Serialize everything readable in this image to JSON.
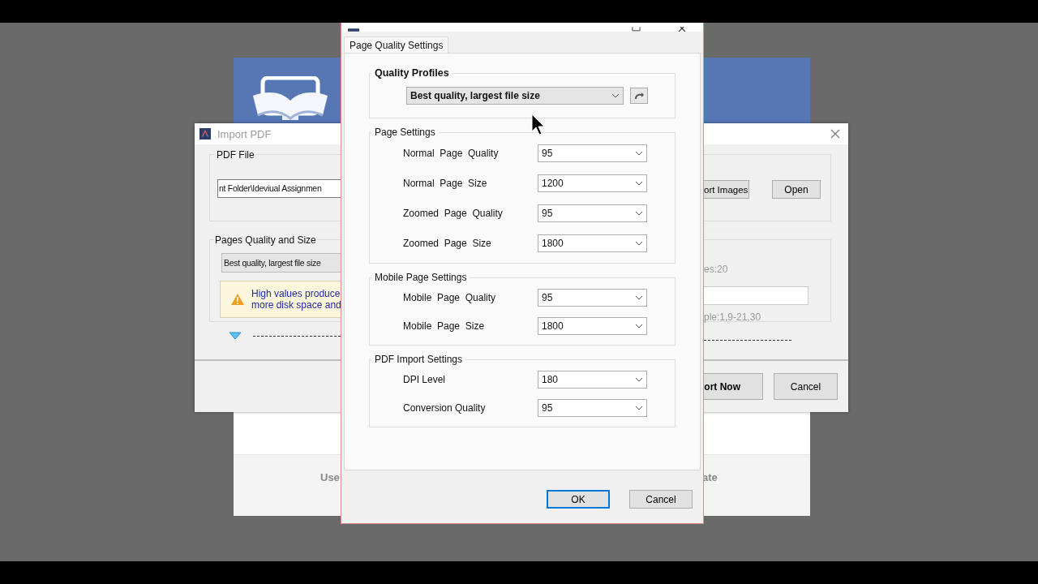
{
  "background_app": {
    "footer_labels": [
      "Use",
      "ate"
    ]
  },
  "import_pdf": {
    "title": "Import PDF",
    "pdf_file": {
      "label": "PDF File",
      "path_value": "nt Folder\\Ideviual Assignmen",
      "buttons": [
        "ort Images",
        "Open"
      ]
    },
    "quality": {
      "label": "Pages Quality and Size",
      "profile": "Best quality, largest file size",
      "warning_lines": [
        "High values produce",
        "more disk space and"
      ]
    },
    "pages": {
      "count_text": "es:20",
      "hint": "ple:1,9-21,30"
    },
    "buttons": [
      {
        "label": "ort Now",
        "default": true
      },
      {
        "label": "Cancel",
        "default": false
      }
    ]
  },
  "quality_settings": {
    "tabs": [
      {
        "label": "Page Quality Settings",
        "selected": true
      }
    ],
    "profiles": {
      "label": "Quality Profiles",
      "value": "Best quality, largest file size"
    },
    "groups": [
      {
        "title": "Page Settings",
        "rows": [
          {
            "label": "Normal  Page  Quality",
            "value": "95"
          },
          {
            "label": "Normal  Page  Size",
            "value": "1200"
          },
          {
            "label": "Zoomed  Page  Quality",
            "value": "95"
          },
          {
            "label": "Zoomed  Page  Size",
            "value": "1800"
          }
        ]
      },
      {
        "title": "Mobile Page Settings",
        "rows": [
          {
            "label": "Mobile  Page  Quality",
            "value": "95"
          },
          {
            "label": "Mobile  Page  Size",
            "value": "1800"
          }
        ]
      },
      {
        "title": "PDF Import Settings",
        "rows": [
          {
            "label": "DPI Level",
            "value": "180"
          },
          {
            "label": "Conversion Quality",
            "value": "95"
          }
        ]
      }
    ],
    "buttons": [
      {
        "label": "OK",
        "default": true
      },
      {
        "label": "Cancel",
        "default": false
      }
    ]
  }
}
